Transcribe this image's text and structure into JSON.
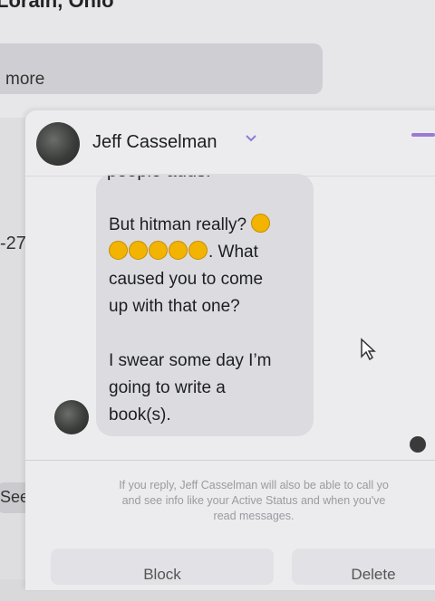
{
  "background": {
    "location_title": "Lorain, Ohio",
    "more_label": "more",
    "left_number": "-27",
    "see_all_label": "See al"
  },
  "chat": {
    "contact_name": "Jeff Casselman",
    "header_chevron_icon": "chevron-down-icon",
    "cut_text": "people adds.",
    "message_lines": [
      "But hitman really?",
      ". What",
      "caused you to come",
      "up with that one?",
      "",
      "I swear some day I’m",
      "going to write a",
      "book(s)."
    ],
    "emoji_icon": "rolling-on-floor-laughing-emoji",
    "emoji_count_line1": 1,
    "emoji_count_line2": 5
  },
  "notice": {
    "line1": "If you reply, Jeff Casselman will also be able to call yo",
    "line2": "and see info like your Active Status and when you've",
    "line3": "read messages."
  },
  "actions": {
    "block_label": "Block",
    "delete_label": "Delete"
  },
  "colors": {
    "accent": "#9b7ad6",
    "bubble": "#dcdce0"
  }
}
